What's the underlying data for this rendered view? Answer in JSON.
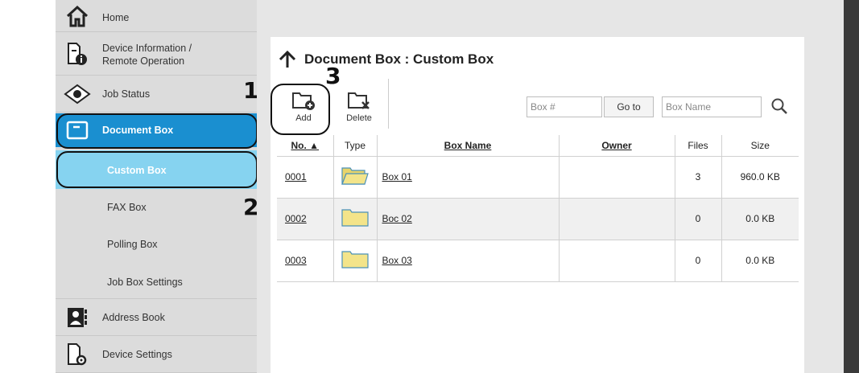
{
  "sidebar": {
    "items": [
      {
        "label": "Home",
        "icon": "home-icon"
      },
      {
        "label": "Device Information /",
        "label2": "Remote Operation",
        "icon": "device-info-icon"
      },
      {
        "label": "Job Status",
        "icon": "eye-icon"
      },
      {
        "label": "Document Box",
        "icon": "folder-icon"
      },
      {
        "label": "Address Book",
        "icon": "address-book-icon"
      },
      {
        "label": "Device Settings",
        "icon": "device-settings-icon"
      }
    ],
    "sub_items": [
      {
        "label": "Custom Box"
      },
      {
        "label": "FAX Box"
      },
      {
        "label": "Polling Box"
      },
      {
        "label": "Job Box Settings"
      }
    ]
  },
  "callouts": {
    "one": "1",
    "two": "2",
    "three": "3"
  },
  "main": {
    "title": "Document Box : Custom Box",
    "toolbar": {
      "add_label": "Add",
      "delete_label": "Delete"
    },
    "search": {
      "box_number_placeholder": "Box #",
      "goto_label": "Go to",
      "box_name_placeholder": "Box Name"
    },
    "table": {
      "headers": {
        "no": "No. ▲",
        "type": "Type",
        "box_name": "Box Name",
        "owner": "Owner",
        "files": "Files",
        "size": "Size"
      },
      "rows": [
        {
          "no": "0001",
          "box_name": "Box 01",
          "owner": "",
          "files": "3",
          "size": "960.0 KB",
          "folder_state": "open"
        },
        {
          "no": "0002",
          "box_name": "Boc 02",
          "owner": "",
          "files": "0",
          "size": "0.0 KB",
          "folder_state": "closed"
        },
        {
          "no": "0003",
          "box_name": "Box 03",
          "owner": "",
          "files": "0",
          "size": "0.0 KB",
          "folder_state": "closed"
        }
      ]
    }
  },
  "colors": {
    "accent": "#1a8fd0",
    "sub_accent": "#86d3f0",
    "folder": "#f3e48a"
  }
}
